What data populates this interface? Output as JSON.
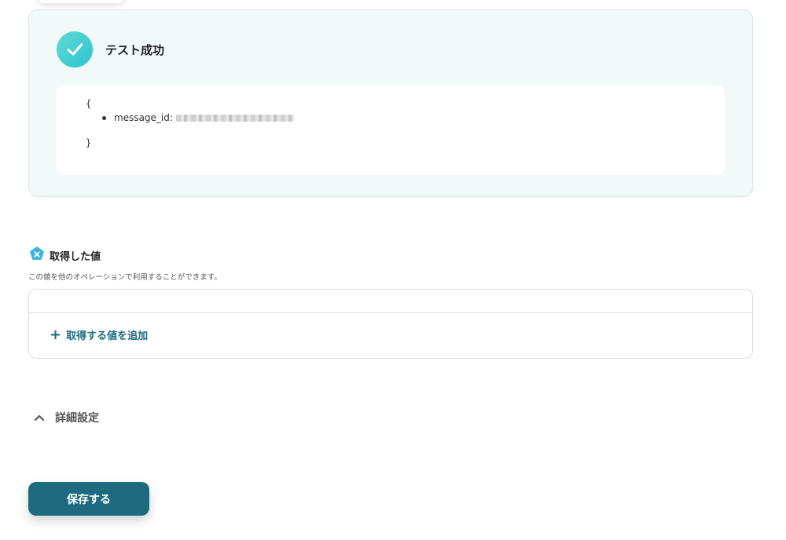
{
  "result_panel": {
    "status_icon": "check-icon",
    "title": "テスト成功",
    "json_open": "{",
    "json_close": "}",
    "items": [
      {
        "key": "message_id:"
      }
    ]
  },
  "acquired_values": {
    "icon": "pentagon-x-icon",
    "title": "取得した値",
    "description": "この値を他のオペレーションで利用することができます。",
    "add_button_icon": "plus-icon",
    "add_button_label": "取得する値を追加"
  },
  "advanced": {
    "icon": "chevron-up-icon",
    "label": "詳細設定"
  },
  "footer": {
    "save_label": "保存する"
  },
  "colors": {
    "accent": "#1e6b7f",
    "success_gradient_start": "#5fdbd4",
    "success_gradient_end": "#2ec3d0",
    "panel_bg": "#f1f9f9",
    "section_icon": "#3bb5dd"
  }
}
